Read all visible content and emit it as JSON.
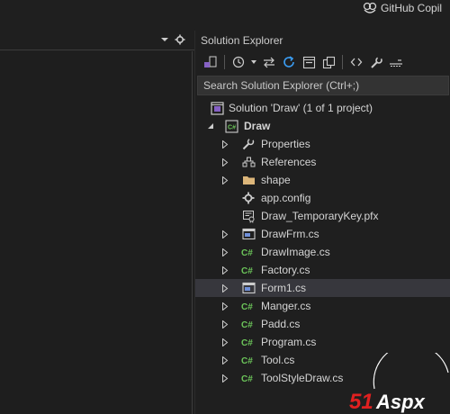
{
  "titlebar": {
    "copilot_label": "GitHub Copil"
  },
  "solution_explorer": {
    "title": "Solution Explorer",
    "search_placeholder": "Search Solution Explorer (Ctrl+;)",
    "solution_label": "Solution 'Draw' (1 of 1 project)",
    "project_label": "Draw",
    "items": [
      {
        "label": "Properties",
        "icon": "wrench-icon",
        "expandable": true
      },
      {
        "label": "References",
        "icon": "references-icon",
        "expandable": true
      },
      {
        "label": "shape",
        "icon": "folder-icon",
        "expandable": true
      },
      {
        "label": "app.config",
        "icon": "config-file-icon",
        "expandable": false
      },
      {
        "label": "Draw_TemporaryKey.pfx",
        "icon": "certificate-icon",
        "expandable": false
      },
      {
        "label": "DrawFrm.cs",
        "icon": "form-icon",
        "expandable": true
      },
      {
        "label": "DrawImage.cs",
        "icon": "csharp-file-icon",
        "expandable": true
      },
      {
        "label": "Factory.cs",
        "icon": "csharp-file-icon",
        "expandable": true
      },
      {
        "label": "Form1.cs",
        "icon": "form-icon",
        "expandable": true,
        "selected": true
      },
      {
        "label": "Manger.cs",
        "icon": "csharp-file-icon",
        "expandable": true
      },
      {
        "label": "Padd.cs",
        "icon": "csharp-file-icon",
        "expandable": true
      },
      {
        "label": "Program.cs",
        "icon": "csharp-file-icon",
        "expandable": true
      },
      {
        "label": "Tool.cs",
        "icon": "csharp-file-icon",
        "expandable": true
      },
      {
        "label": "ToolStyleDraw.cs",
        "icon": "csharp-file-icon",
        "expandable": true
      }
    ]
  },
  "watermark": {
    "text": "51Aspx"
  },
  "colors": {
    "background": "#1f1f1f",
    "selection": "#37373d",
    "csharp_green": "#6cc55a",
    "watermark_red": "#e02020"
  }
}
